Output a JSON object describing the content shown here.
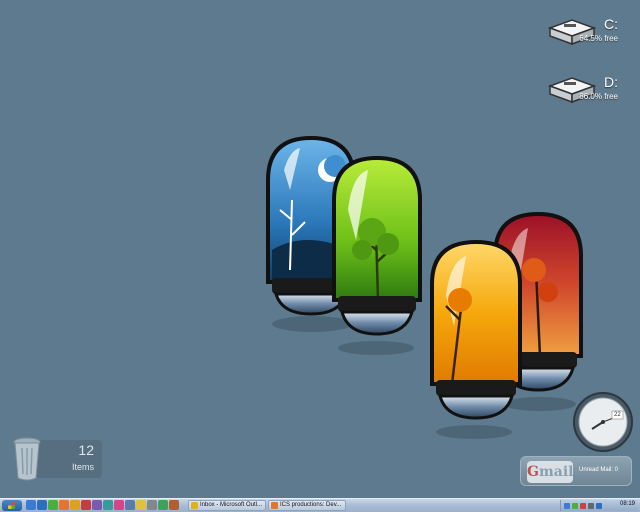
{
  "drives": [
    {
      "letter": "C:",
      "free": "64.5% free"
    },
    {
      "letter": "D:",
      "free": "86.0% free"
    }
  ],
  "recycle_bin": {
    "count": "12",
    "label": "Items"
  },
  "clock": {
    "date": "22"
  },
  "gmail": {
    "logo_g": "G",
    "logo_rest": "mail",
    "unread": "Unread Mail: 0"
  },
  "taskbar": {
    "tasks": [
      {
        "label": "Inbox - Microsoft Outl..."
      },
      {
        "label": "ICS productions: Dev..."
      }
    ],
    "time": "08:19"
  },
  "colors": {
    "desktop": "#5e7a8e",
    "winter": "#3f8fd0",
    "spring": "#7cc520",
    "autumn": "#f0a800",
    "fall": "#c0282c"
  },
  "icons": {
    "drive": "hard-drive-icon",
    "recycle": "recycle-bin-icon",
    "clock": "clock-icon",
    "mail": "gmail-icon",
    "start": "windows-logo-icon"
  }
}
